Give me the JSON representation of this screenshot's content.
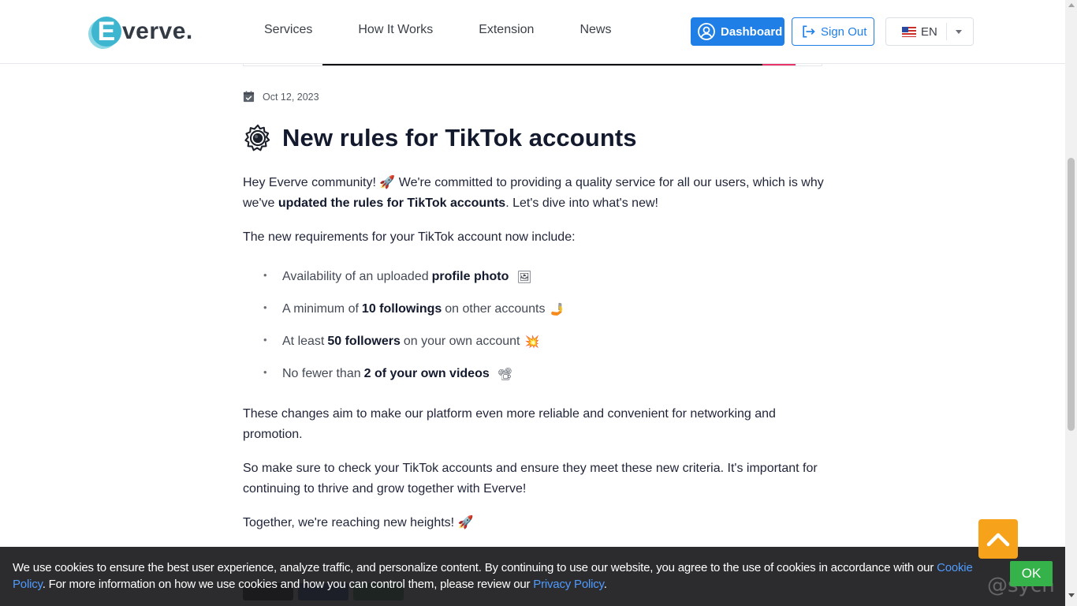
{
  "header": {
    "logo_letter": "E",
    "logo_text": "verve.",
    "nav": [
      "Services",
      "How It Works",
      "Extension",
      "News"
    ],
    "dashboard_label": "Dashboard",
    "signout_label": "Sign Out",
    "language": "EN"
  },
  "article": {
    "date": "Oct 12, 2023",
    "title_emoji": "⚙️",
    "title": "New rules for TikTok accounts",
    "intro": {
      "t1": "Hey Everve community! ",
      "e1": "🚀",
      "t2": " We're committed to providing a quality service for all our users, which is why we've ",
      "bold": "updated the rules for TikTok accounts",
      "t3": ". Let's dive into what's new!"
    },
    "requirements_intro": "The new requirements for your TikTok account now include:",
    "requirements": [
      {
        "pre": "Availability of an uploaded",
        "bold": "profile photo",
        "post": "",
        "emoji": "🖼"
      },
      {
        "pre": "A minimum of",
        "bold": "10 followings",
        "post": "on other accounts",
        "emoji": "🤳"
      },
      {
        "pre": "At least",
        "bold": "50 followers",
        "post": "on your own account",
        "emoji": "💥"
      },
      {
        "pre": "No fewer than",
        "bold": "2 of your own videos",
        "post": "",
        "emoji": "📽"
      }
    ],
    "para2": "These changes aim to make our platform even more reliable and convenient for networking and promotion.",
    "para3": "So make sure to check your TikTok accounts and ensure they meet these new criteria. It's important for continuing to thrive and grow together with Everve!",
    "closing": "Together, we're reaching new heights! ",
    "closing_emoji": "🚀"
  },
  "cookie": {
    "t1": "We use cookies to ensure the best user experience, analyze traffic, and personalize content. By continuing to use our website, you agree to the use of cookies in accordance with our ",
    "cookie_policy": "Cookie Policy",
    "t2": ". For more information on how we use cookies and how you can control them, please review our ",
    "privacy_policy": "Privacy Policy",
    "t3": ".",
    "ok_label": "OK",
    "watermark": "@sych"
  },
  "colors": {
    "primary": "#1f7fe6",
    "logo": "#3fb6d0",
    "to_top": "#f7a21b",
    "ok_button": "#36b24a",
    "cookie_bg": "#1c1c1e"
  }
}
